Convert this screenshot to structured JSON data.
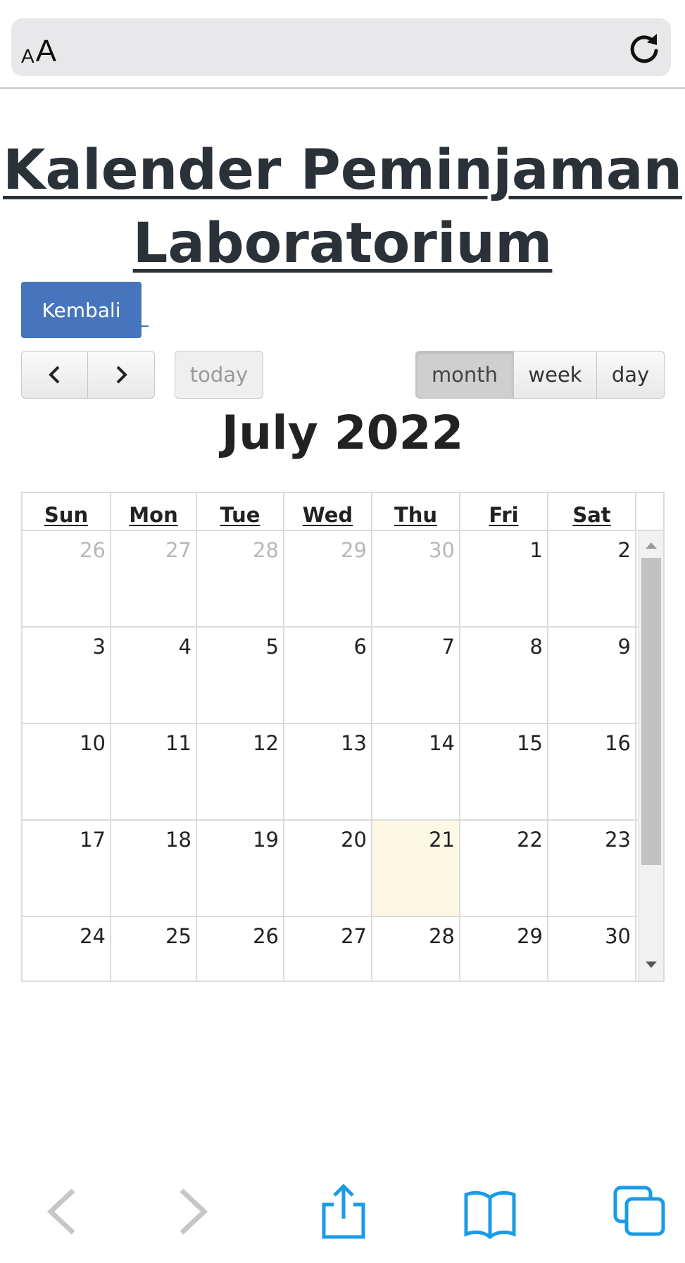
{
  "browser": {
    "text_size_small": "A",
    "text_size_big": "A",
    "reload_icon": "reload-icon",
    "accent_color": "#1a9be8"
  },
  "page": {
    "title": "Kalender Peminjaman Laboratorium",
    "back_button": "Kembali"
  },
  "toolbar": {
    "prev_icon": "chevron-left-icon",
    "next_icon": "chevron-right-icon",
    "today_label": "today",
    "views": [
      "month",
      "week",
      "day"
    ],
    "active_view": "month",
    "title": "July 2022"
  },
  "calendar": {
    "weekdays": [
      "Sun",
      "Mon",
      "Tue",
      "Wed",
      "Thu",
      "Fri",
      "Sat"
    ],
    "today": "21",
    "today_color": "#fcf8e3",
    "weeks": [
      [
        {
          "d": "26",
          "other": true
        },
        {
          "d": "27",
          "other": true
        },
        {
          "d": "28",
          "other": true
        },
        {
          "d": "29",
          "other": true
        },
        {
          "d": "30",
          "other": true
        },
        {
          "d": "1"
        },
        {
          "d": "2"
        }
      ],
      [
        {
          "d": "3"
        },
        {
          "d": "4"
        },
        {
          "d": "5"
        },
        {
          "d": "6"
        },
        {
          "d": "7"
        },
        {
          "d": "8"
        },
        {
          "d": "9"
        }
      ],
      [
        {
          "d": "10"
        },
        {
          "d": "11"
        },
        {
          "d": "12"
        },
        {
          "d": "13"
        },
        {
          "d": "14"
        },
        {
          "d": "15"
        },
        {
          "d": "16"
        }
      ],
      [
        {
          "d": "17"
        },
        {
          "d": "18"
        },
        {
          "d": "19"
        },
        {
          "d": "20"
        },
        {
          "d": "21",
          "today": true
        },
        {
          "d": "22"
        },
        {
          "d": "23"
        }
      ],
      [
        {
          "d": "24"
        },
        {
          "d": "25"
        },
        {
          "d": "26"
        },
        {
          "d": "27"
        },
        {
          "d": "28"
        },
        {
          "d": "29"
        },
        {
          "d": "30"
        }
      ]
    ]
  },
  "bottom_bar": {
    "icons": [
      "back-icon",
      "forward-icon",
      "share-icon",
      "bookmarks-icon",
      "tabs-icon"
    ]
  }
}
